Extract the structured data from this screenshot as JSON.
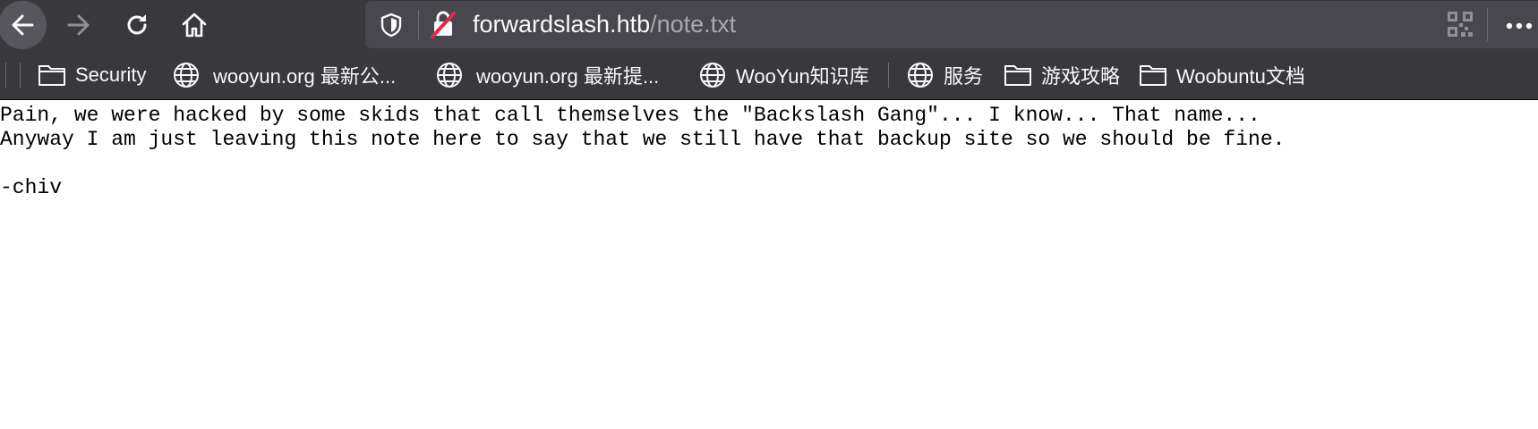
{
  "browser": {
    "url_domain": "forwardslash.htb",
    "url_path": "/note.txt"
  },
  "bookmarks": [
    {
      "label": "Security",
      "icon": "folder-icon"
    },
    {
      "label": "wooyun.org 最新公...",
      "icon": "globe-icon"
    },
    {
      "label": "wooyun.org 最新提...",
      "icon": "globe-icon"
    },
    {
      "label": "WooYun知识库",
      "icon": "globe-icon"
    },
    {
      "label": "服务",
      "icon": "globe-icon"
    },
    {
      "label": "游戏攻略",
      "icon": "folder-icon"
    },
    {
      "label": "Woobuntu文档",
      "icon": "folder-icon"
    }
  ],
  "page": {
    "lines": [
      "Pain, we were hacked by some skids that call themselves the \"Backslash Gang\"... I know... That name...",
      "Anyway I am just leaving this note here to say that we still have that backup site so we should be fine.",
      "",
      "-chiv"
    ]
  }
}
